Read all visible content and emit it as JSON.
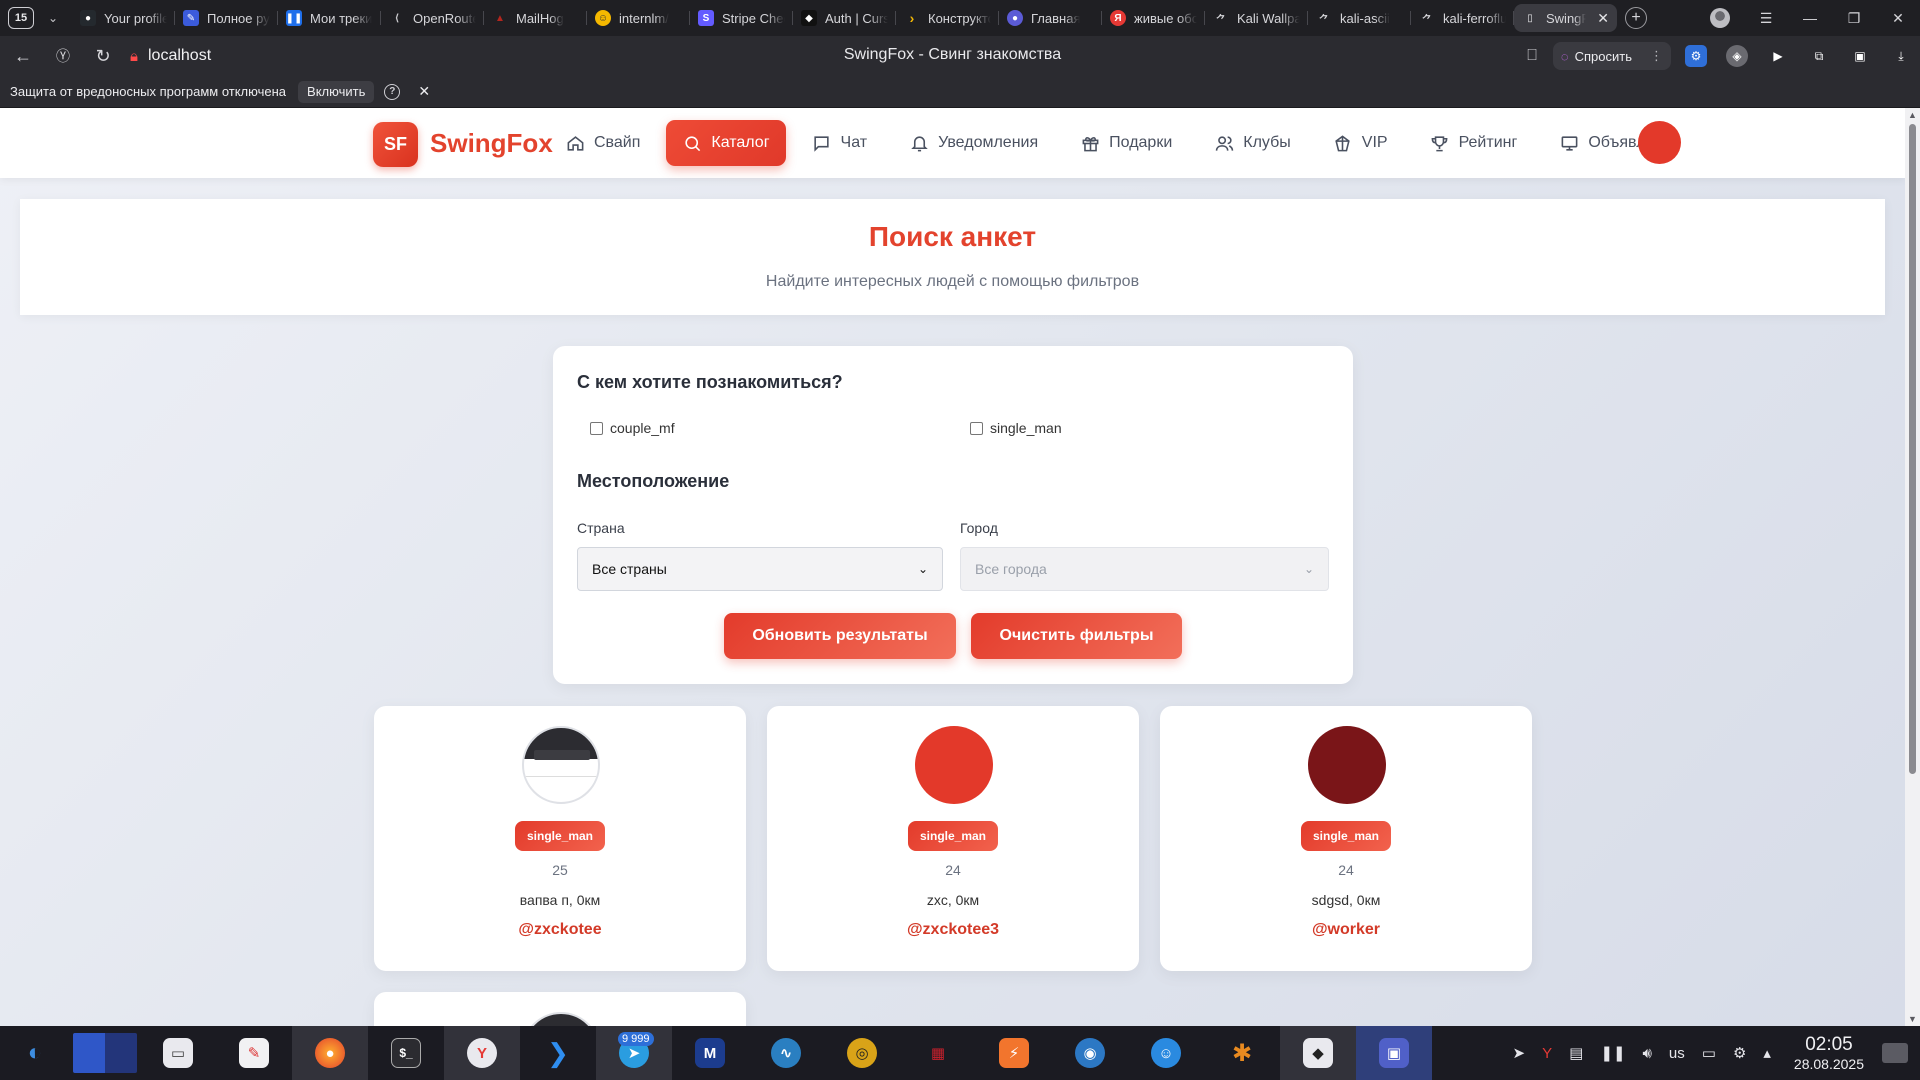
{
  "browser": {
    "tab_count": "15",
    "tabs": [
      {
        "label": "Your profile",
        "icon": "github-icon",
        "color": "#24292e"
      },
      {
        "label": "Полное руководство",
        "icon": "dev-icon",
        "color": "#3b5bdb"
      },
      {
        "label": "Мои треки",
        "icon": "tracker-icon",
        "color": "#1f6feb"
      },
      {
        "label": "OpenRouter",
        "icon": "openrouter-icon",
        "color": "#6b6b70"
      },
      {
        "label": "MailHog",
        "icon": "mailhog-icon",
        "color": "#b3261e"
      },
      {
        "label": "internlm/",
        "icon": "hf-icon",
        "color": "#f5b800"
      },
      {
        "label": "Stripe Checkout",
        "icon": "stripe-icon",
        "color": "#635bff"
      },
      {
        "label": "Auth | Cursor",
        "icon": "cursor-icon",
        "color": "#111111"
      },
      {
        "label": "Конструктор",
        "icon": "arrow-icon",
        "color": "#f2b705"
      },
      {
        "label": "Главная",
        "icon": "globe-icon",
        "color": "#5b5bd6"
      },
      {
        "label": "живые обои",
        "icon": "yandex-icon",
        "color": "#e53935"
      },
      {
        "label": "Kali Wallpaper",
        "icon": "kali-icon",
        "color": "#2b2b30"
      },
      {
        "label": "kali-ascii",
        "icon": "kali-icon",
        "color": "#2b2b30"
      },
      {
        "label": "kali-ferrofluid",
        "icon": "kali-icon",
        "color": "#2b2b30"
      },
      {
        "label": "SwingFox",
        "icon": "page-icon",
        "color": "#3b3b41",
        "active": true
      }
    ],
    "url": "localhost",
    "page_title": "SwingFox - Свинг знакомства",
    "ask_label": "Спросить",
    "infobar_text": "Защита от вредоносных программ отключена",
    "infobar_button": "Включить"
  },
  "site": {
    "logo_mark": "SF",
    "logo_text": "SwingFox",
    "nav": [
      {
        "label": "Свайп",
        "icon": "home-icon"
      },
      {
        "label": "Каталог",
        "icon": "search-icon",
        "active": true
      },
      {
        "label": "Чат",
        "icon": "chat-icon"
      },
      {
        "label": "Уведомления",
        "icon": "bell-icon"
      },
      {
        "label": "Подарки",
        "icon": "gift-icon"
      },
      {
        "label": "Клубы",
        "icon": "users-icon"
      },
      {
        "label": "VIP",
        "icon": "crown-icon"
      },
      {
        "label": "Рейтинг",
        "icon": "trophy-icon"
      },
      {
        "label": "Объявления",
        "icon": "monitor-icon"
      }
    ],
    "avatar_color": "#e3392a"
  },
  "hero": {
    "title": "Поиск анкет",
    "subtitle": "Найдите интересных людей с помощью фильтров"
  },
  "filters": {
    "looking_for_title": "С кем хотите познакомиться?",
    "options": [
      "couple_mf",
      "single_man"
    ],
    "location_title": "Местоположение",
    "country_label": "Страна",
    "country_value": "Все страны",
    "city_label": "Город",
    "city_value": "Все города",
    "update_button": "Обновить результаты",
    "clear_button": "Очистить фильтры"
  },
  "profiles": [
    {
      "type": "single_man",
      "age": "25",
      "location": "вапва п, 0км",
      "handle": "@zxckotee",
      "avatar": "screenshot"
    },
    {
      "type": "single_man",
      "age": "24",
      "location": "zxc, 0км",
      "handle": "@zxckotee3",
      "avatar_color": "#e3392a"
    },
    {
      "type": "single_man",
      "age": "24",
      "location": "sdgsd, 0км",
      "handle": "@worker",
      "avatar_color": "#7a1518"
    }
  ],
  "taskbar": {
    "apps": [
      "start-icon",
      "desktop-switcher-icon",
      "files-icon",
      "text-editor-icon",
      "firefox-icon",
      "terminal-icon",
      "yandex-browser-icon",
      "vscode-icon",
      "telegram-icon",
      "metasploit-icon",
      "wireshark-icon",
      "ghidra-icon",
      "burp-icon",
      "sublime-icon",
      "zenmap-icon",
      "hexchat-icon",
      "spider-icon",
      "cursor-app-icon",
      "screenshot-app-icon"
    ],
    "telegram_badge": "9 999",
    "lang": "us",
    "time": "02:05",
    "date": "28.08.2025"
  }
}
